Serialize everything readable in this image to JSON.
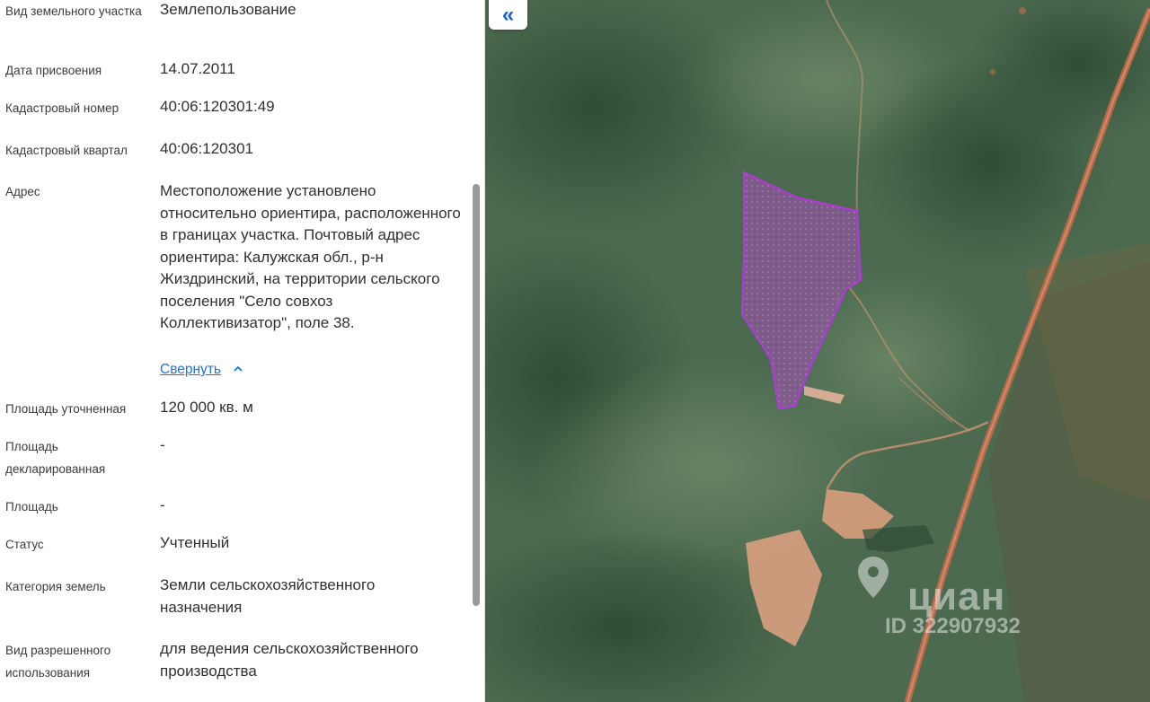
{
  "panel": {
    "rows": [
      {
        "label": "Вид земельного участка",
        "value": "Землепользование"
      },
      {
        "label": "Дата присвоения",
        "value": "14.07.2011"
      },
      {
        "label": "Кадастровый номер",
        "value": "40:06:120301:49"
      },
      {
        "label": "Кадастровый квартал",
        "value": "40:06:120301"
      },
      {
        "label": "Адрес",
        "value": "Местоположение установлено относительно ориентира, расположенного в границах участка. Почтовый адрес ориентира: Калужская обл., р-н Жиздринский, на территории сельского поселения \"Село совхоз Коллективизатор\", поле 38."
      },
      {
        "label": "Площадь уточненная",
        "value": "120 000 кв. м"
      },
      {
        "label": "Площадь декларированная",
        "value": "-"
      },
      {
        "label": "Площадь",
        "value": "-"
      },
      {
        "label": "Статус",
        "value": "Учтенный"
      },
      {
        "label": "Категория земель",
        "value": "Земли сельскохозяйственного назначения"
      },
      {
        "label": "Вид разрешенного использования",
        "value": "для ведения сельскохозяйственного производства"
      }
    ],
    "collapse_link": "Свернуть"
  },
  "map": {
    "collapse_button_icon": "double-chevron-left-icon",
    "watermark": {
      "brand": "циан",
      "id": "ID 322907932",
      "icon": "location-pin-icon"
    },
    "parcel_color": "#b03ad8"
  }
}
